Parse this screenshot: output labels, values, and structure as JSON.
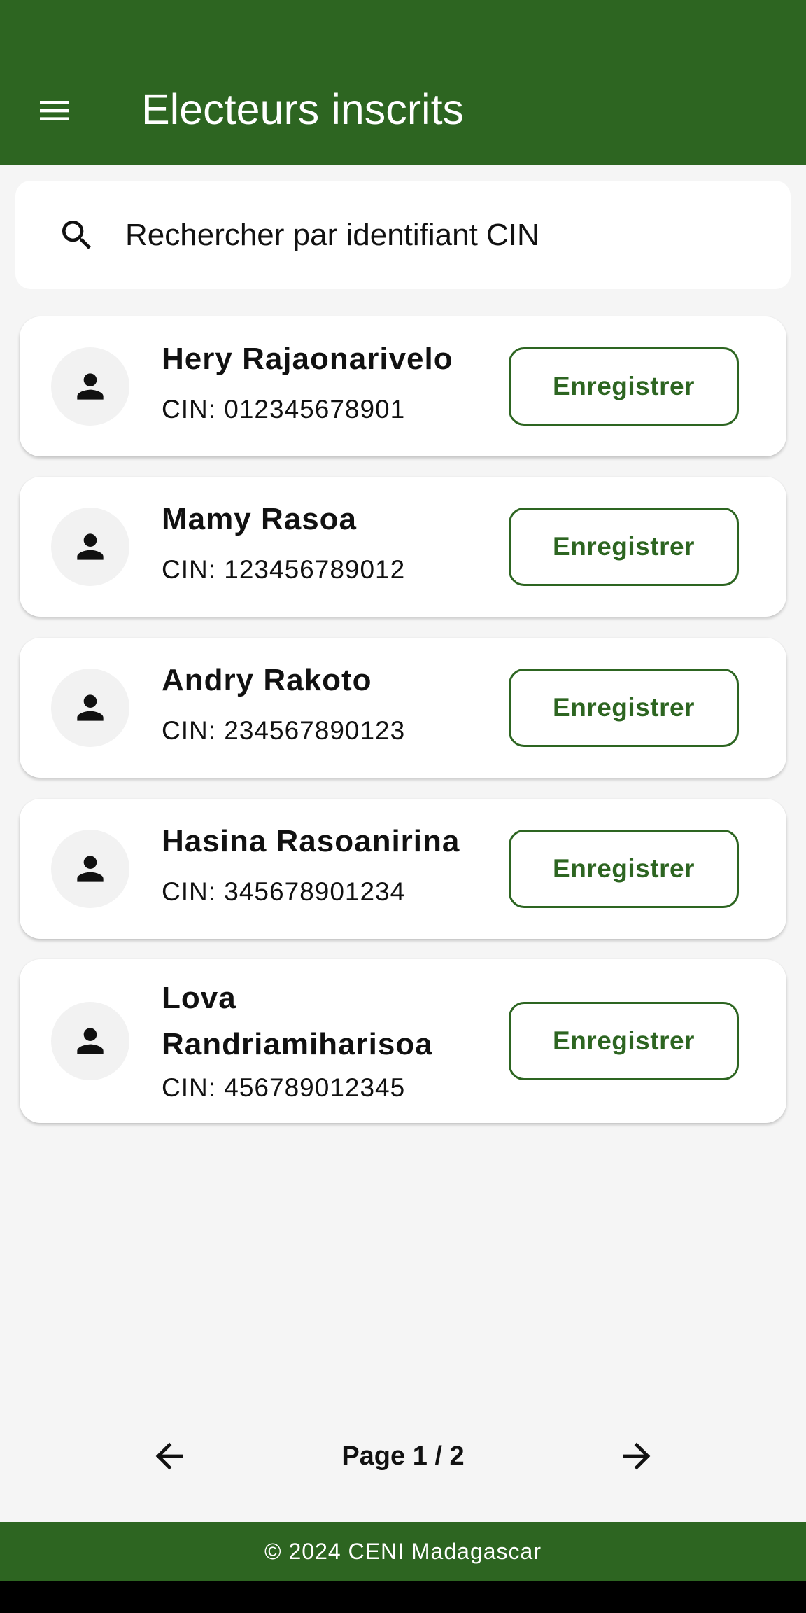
{
  "app": {
    "title": "Electeurs inscrits",
    "menu_icon": "menu-icon",
    "brand_color": "#2d6521"
  },
  "search": {
    "icon": "search-icon",
    "placeholder": "Rechercher par identifiant CIN",
    "value": ""
  },
  "voters": [
    {
      "name": "Hery Rajaonarivelo",
      "cin": "CIN: 012345678901",
      "action": "Enregistrer",
      "avatar_icon": "person-icon"
    },
    {
      "name": "Mamy Rasoa",
      "cin": "CIN: 123456789012",
      "action": "Enregistrer",
      "avatar_icon": "person-icon"
    },
    {
      "name": "Andry Rakoto",
      "cin": "CIN: 234567890123",
      "action": "Enregistrer",
      "avatar_icon": "person-icon"
    },
    {
      "name": "Hasina Rasoanirina",
      "cin": "CIN: 345678901234",
      "action": "Enregistrer",
      "avatar_icon": "person-icon"
    },
    {
      "name": "Lova Randriamiharisoa",
      "cin": "CIN: 456789012345",
      "action": "Enregistrer",
      "avatar_icon": "person-icon"
    }
  ],
  "pagination": {
    "label": "Page 1 / 2",
    "prev_icon": "arrow-left-icon",
    "next_icon": "arrow-right-icon"
  },
  "footer": {
    "text": "© 2024 CENI Madagascar"
  }
}
